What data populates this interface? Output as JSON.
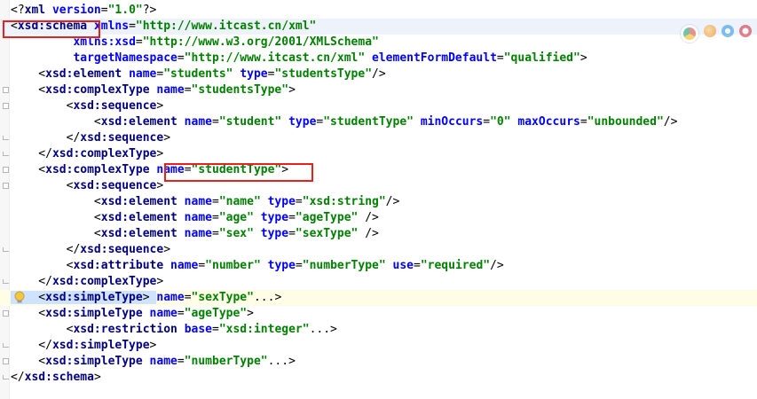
{
  "editor": {
    "lines": [
      [
        [
          "p",
          "<?"
        ],
        [
          "t",
          "xml "
        ],
        [
          "a",
          "version"
        ],
        [
          "p",
          "="
        ],
        [
          "v",
          "\"1.0\""
        ],
        [
          "p",
          "?>"
        ]
      ],
      [
        [
          "p",
          "<"
        ],
        [
          "t",
          "xsd:schema "
        ],
        [
          "a",
          "xmlns"
        ],
        [
          "p",
          "="
        ],
        [
          "v",
          "\"http://www.itcast.cn/xml\""
        ]
      ],
      [
        [
          "p",
          "         "
        ],
        [
          "a",
          "xmlns:xsd"
        ],
        [
          "p",
          "="
        ],
        [
          "v",
          "\"http://www.w3.org/2001/XMLSchema\""
        ]
      ],
      [
        [
          "p",
          "         "
        ],
        [
          "a",
          "targetNamespace"
        ],
        [
          "p",
          "="
        ],
        [
          "v",
          "\"http://www.itcast.cn/xml\""
        ],
        [
          "p",
          " "
        ],
        [
          "a",
          "elementFormDefault"
        ],
        [
          "p",
          "="
        ],
        [
          "v",
          "\"qualified\""
        ],
        [
          "p",
          ">"
        ]
      ],
      [
        [
          "p",
          "    <"
        ],
        [
          "t",
          "xsd:element "
        ],
        [
          "a",
          "name"
        ],
        [
          "p",
          "="
        ],
        [
          "v",
          "\"students\""
        ],
        [
          "p",
          " "
        ],
        [
          "a",
          "type"
        ],
        [
          "p",
          "="
        ],
        [
          "v",
          "\"studentsType\""
        ],
        [
          "p",
          "/>"
        ]
      ],
      [
        [
          "p",
          "    <"
        ],
        [
          "t",
          "xsd:complexType "
        ],
        [
          "a",
          "name"
        ],
        [
          "p",
          "="
        ],
        [
          "v",
          "\"studentsType\""
        ],
        [
          "p",
          ">"
        ]
      ],
      [
        [
          "p",
          "        <"
        ],
        [
          "t",
          "xsd:sequence"
        ],
        [
          "p",
          ">"
        ]
      ],
      [
        [
          "p",
          "            <"
        ],
        [
          "t",
          "xsd:element "
        ],
        [
          "a",
          "name"
        ],
        [
          "p",
          "="
        ],
        [
          "v",
          "\"student\""
        ],
        [
          "p",
          " "
        ],
        [
          "a",
          "type"
        ],
        [
          "p",
          "="
        ],
        [
          "v",
          "\"studentType\""
        ],
        [
          "p",
          " "
        ],
        [
          "a",
          "minOccurs"
        ],
        [
          "p",
          "="
        ],
        [
          "v",
          "\"0\""
        ],
        [
          "p",
          " "
        ],
        [
          "a",
          "maxOccurs"
        ],
        [
          "p",
          "="
        ],
        [
          "v",
          "\"unbounded\""
        ],
        [
          "p",
          "/>"
        ]
      ],
      [
        [
          "p",
          "        </"
        ],
        [
          "t",
          "xsd:sequence"
        ],
        [
          "p",
          ">"
        ]
      ],
      [
        [
          "p",
          "    </"
        ],
        [
          "t",
          "xsd:complexType"
        ],
        [
          "p",
          ">"
        ]
      ],
      [
        [
          "p",
          "    <"
        ],
        [
          "t",
          "xsd:complexType "
        ],
        [
          "a",
          "name"
        ],
        [
          "p",
          "="
        ],
        [
          "v",
          "\"studentType\""
        ],
        [
          "p",
          ">"
        ]
      ],
      [
        [
          "p",
          "        <"
        ],
        [
          "t",
          "xsd:sequence"
        ],
        [
          "p",
          ">"
        ]
      ],
      [
        [
          "p",
          "            <"
        ],
        [
          "t",
          "xsd:element "
        ],
        [
          "a",
          "name"
        ],
        [
          "p",
          "="
        ],
        [
          "v",
          "\"name\""
        ],
        [
          "p",
          " "
        ],
        [
          "a",
          "type"
        ],
        [
          "p",
          "="
        ],
        [
          "v",
          "\"xsd:string\""
        ],
        [
          "p",
          "/>"
        ]
      ],
      [
        [
          "p",
          "            <"
        ],
        [
          "t",
          "xsd:element "
        ],
        [
          "a",
          "name"
        ],
        [
          "p",
          "="
        ],
        [
          "v",
          "\"age\""
        ],
        [
          "p",
          " "
        ],
        [
          "a",
          "type"
        ],
        [
          "p",
          "="
        ],
        [
          "v",
          "\"ageType\""
        ],
        [
          "p",
          " />"
        ]
      ],
      [
        [
          "p",
          "            <"
        ],
        [
          "t",
          "xsd:element "
        ],
        [
          "a",
          "name"
        ],
        [
          "p",
          "="
        ],
        [
          "v",
          "\"sex\""
        ],
        [
          "p",
          " "
        ],
        [
          "a",
          "type"
        ],
        [
          "p",
          "="
        ],
        [
          "v",
          "\"sexType\""
        ],
        [
          "p",
          " />"
        ]
      ],
      [
        [
          "p",
          "        </"
        ],
        [
          "t",
          "xsd:sequence"
        ],
        [
          "p",
          ">"
        ]
      ],
      [
        [
          "p",
          "        <"
        ],
        [
          "t",
          "xsd:attribute "
        ],
        [
          "a",
          "name"
        ],
        [
          "p",
          "="
        ],
        [
          "v",
          "\"number\""
        ],
        [
          "p",
          " "
        ],
        [
          "a",
          "type"
        ],
        [
          "p",
          "="
        ],
        [
          "v",
          "\"numberType\""
        ],
        [
          "p",
          " "
        ],
        [
          "a",
          "use"
        ],
        [
          "p",
          "="
        ],
        [
          "v",
          "\"required\""
        ],
        [
          "p",
          "/>"
        ]
      ],
      [
        [
          "p",
          "    </"
        ],
        [
          "t",
          "xsd:complexType"
        ],
        [
          "p",
          ">"
        ]
      ],
      [
        [
          "p",
          "    <"
        ],
        [
          "t",
          "xsd:simpleType"
        ],
        [
          "p",
          "> "
        ],
        [
          "a",
          "name"
        ],
        [
          "p",
          "="
        ],
        [
          "v",
          "\"sexType\""
        ],
        [
          "p",
          "...>"
        ]
      ],
      [
        [
          "p",
          "    <"
        ],
        [
          "t",
          "xsd:simpleType "
        ],
        [
          "a",
          "name"
        ],
        [
          "p",
          "="
        ],
        [
          "v",
          "\"ageType\""
        ],
        [
          "p",
          ">"
        ]
      ],
      [
        [
          "p",
          "        <"
        ],
        [
          "t",
          "xsd:restriction "
        ],
        [
          "a",
          "base"
        ],
        [
          "p",
          "="
        ],
        [
          "v",
          "\"xsd:integer\""
        ],
        [
          "p",
          "...>"
        ]
      ],
      [
        [
          "p",
          "    </"
        ],
        [
          "t",
          "xsd:simpleType"
        ],
        [
          "p",
          ">"
        ]
      ],
      [
        [
          "p",
          "    <"
        ],
        [
          "t",
          "xsd:simpleType "
        ],
        [
          "a",
          "name"
        ],
        [
          "p",
          "="
        ],
        [
          "v",
          "\"numberType\""
        ],
        [
          "p",
          "...>"
        ]
      ],
      [
        [
          "p",
          "</"
        ],
        [
          "t",
          "xsd:schema"
        ],
        [
          "p",
          ">"
        ]
      ]
    ]
  },
  "icons": [
    "lightbulb-icon",
    "chrome-icon",
    "firefox-icon",
    "ie-icon",
    "opera-icon"
  ]
}
